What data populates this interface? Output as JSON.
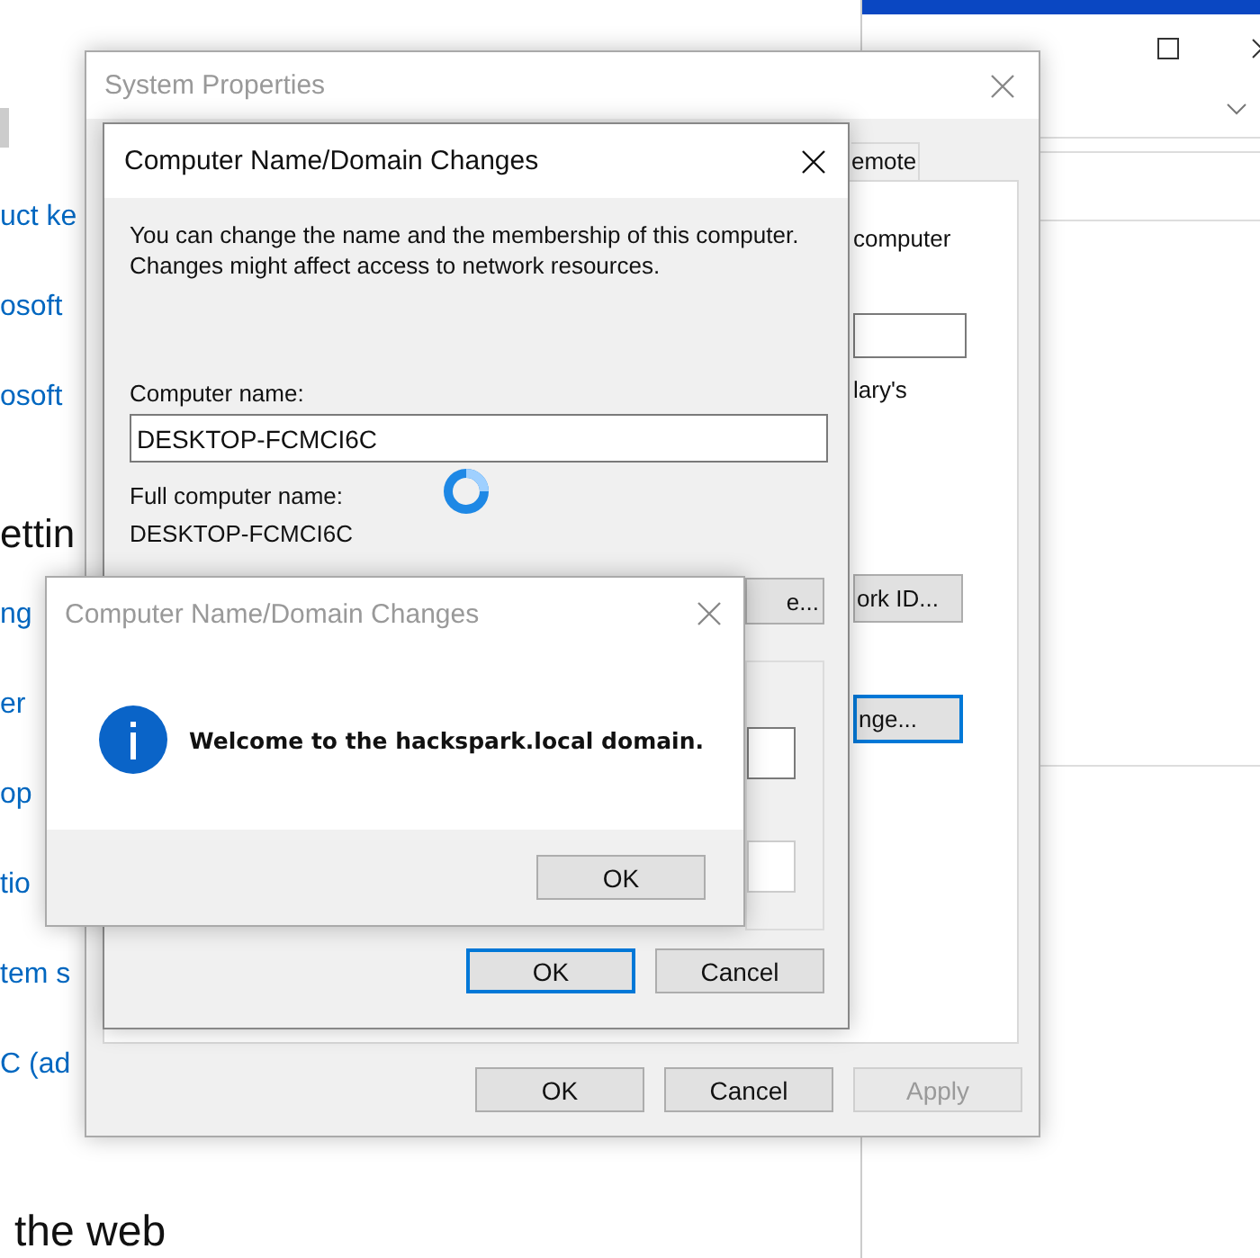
{
  "settings_page": {
    "items": [
      {
        "kind": "block"
      },
      {
        "kind": "link",
        "text": "uct ke"
      },
      {
        "kind": "link",
        "text": "osoft"
      },
      {
        "kind": "link",
        "text": "osoft"
      },
      {
        "kind": "heading",
        "text": "ettin"
      },
      {
        "kind": "link",
        "text": "ng"
      },
      {
        "kind": "link",
        "text": "er"
      },
      {
        "kind": "link",
        "text": "op"
      },
      {
        "kind": "link",
        "text": "tio"
      },
      {
        "kind": "link",
        "text": "tem s"
      },
      {
        "kind": "link",
        "text": "C (ad"
      },
      {
        "kind": "heading",
        "text": "the web"
      }
    ]
  },
  "system_properties": {
    "title": "System Properties",
    "tab": {
      "label": "emote",
      "selected": false
    },
    "panel_texts": [
      "computer",
      "lary's"
    ],
    "panel_buttons": [
      {
        "label": "ork ID...",
        "focused": false
      },
      {
        "label": "nge...",
        "focused": true
      }
    ],
    "buttons": [
      {
        "label": "OK",
        "disabled": false
      },
      {
        "label": "Cancel",
        "disabled": false
      },
      {
        "label": "Apply",
        "disabled": true
      }
    ]
  },
  "name_dialog": {
    "title": "Computer Name/Domain Changes",
    "description": "You can change the name and the membership of this computer. Changes might affect access to network resources.",
    "computer_name_label": "Computer name:",
    "computer_name": "DESKTOP-FCMCI6C",
    "full_name_label": "Full computer name:",
    "full_name": "DESKTOP-FCMCI6C",
    "more_button": "e...",
    "buttons": [
      {
        "label": "OK",
        "default": true
      },
      {
        "label": "Cancel",
        "default": false
      }
    ]
  },
  "message_box": {
    "title": "Computer Name/Domain Changes",
    "message": "Welcome to the hackspark.local domain.",
    "button": "OK"
  }
}
